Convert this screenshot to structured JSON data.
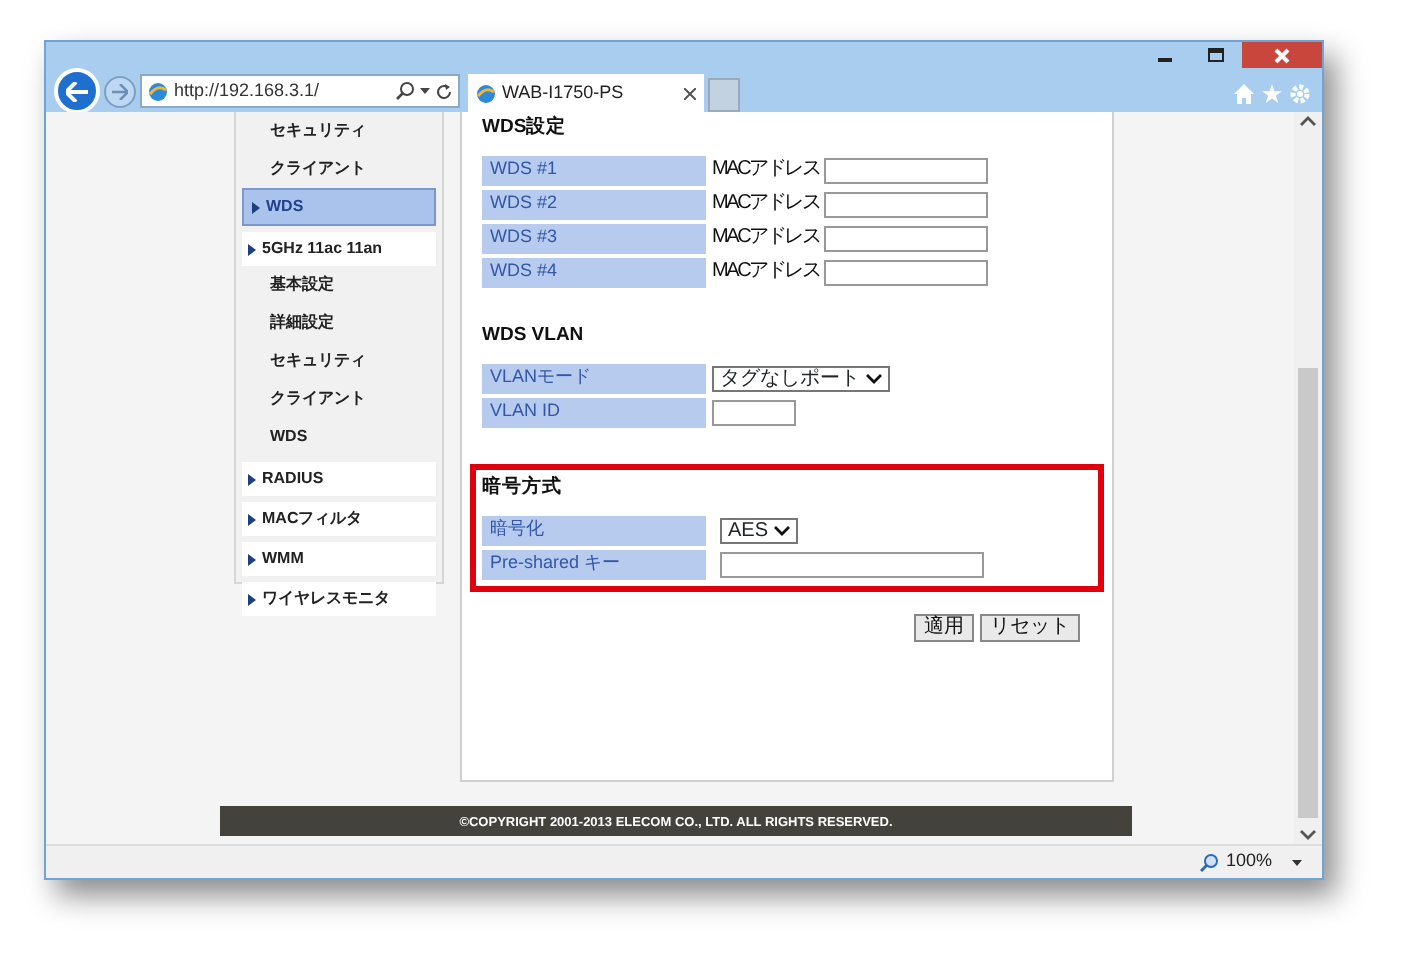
{
  "window": {
    "url": "http://192.168.3.1/",
    "tab_title": "WAB-I1750-PS",
    "zoom": "100%"
  },
  "sidebar": [
    {
      "children": [
        {
          "label": "セキュリティ",
          "selected": false
        },
        {
          "label": "クライアント",
          "selected": false
        },
        {
          "label": "WDS",
          "selected": true
        }
      ]
    },
    {
      "label": "5GHz 11ac 11an",
      "children": [
        {
          "label": "基本設定",
          "selected": false
        },
        {
          "label": "詳細設定",
          "selected": false
        },
        {
          "label": "セキュリティ",
          "selected": false
        },
        {
          "label": "クライアント",
          "selected": false
        },
        {
          "label": "WDS",
          "selected": false
        }
      ]
    },
    {
      "label": "RADIUS"
    },
    {
      "label": "MACフィルタ"
    },
    {
      "label": "WMM"
    },
    {
      "label": "ワイヤレスモニタ"
    }
  ],
  "sections": [
    {
      "heading": "WDS設定",
      "rows": [
        {
          "label": "WDS #1",
          "kind": "text",
          "prefix": "MACアドレス",
          "value": ""
        },
        {
          "label": "WDS #2",
          "kind": "text",
          "prefix": "MACアドレス",
          "value": ""
        },
        {
          "label": "WDS #3",
          "kind": "text",
          "prefix": "MACアドレス",
          "value": ""
        },
        {
          "label": "WDS #4",
          "kind": "text",
          "prefix": "MACアドレス",
          "value": ""
        }
      ]
    },
    {
      "heading": "WDS VLAN",
      "rows": [
        {
          "label": "VLANモード",
          "kind": "select",
          "value": "タグなしポート"
        },
        {
          "label": "VLAN ID",
          "kind": "short",
          "value": ""
        }
      ]
    },
    {
      "heading": "暗号方式",
      "highlighted": true,
      "rows": [
        {
          "label": "暗号化",
          "kind": "select",
          "value": "AES"
        },
        {
          "label": "Pre-shared キー",
          "kind": "wide",
          "value": ""
        }
      ]
    }
  ],
  "buttons": [
    "適用",
    "リセット"
  ],
  "footer": "©COPYRIGHT 2001-2013 ELECOM CO., LTD. ALL RIGHTS RESERVED."
}
